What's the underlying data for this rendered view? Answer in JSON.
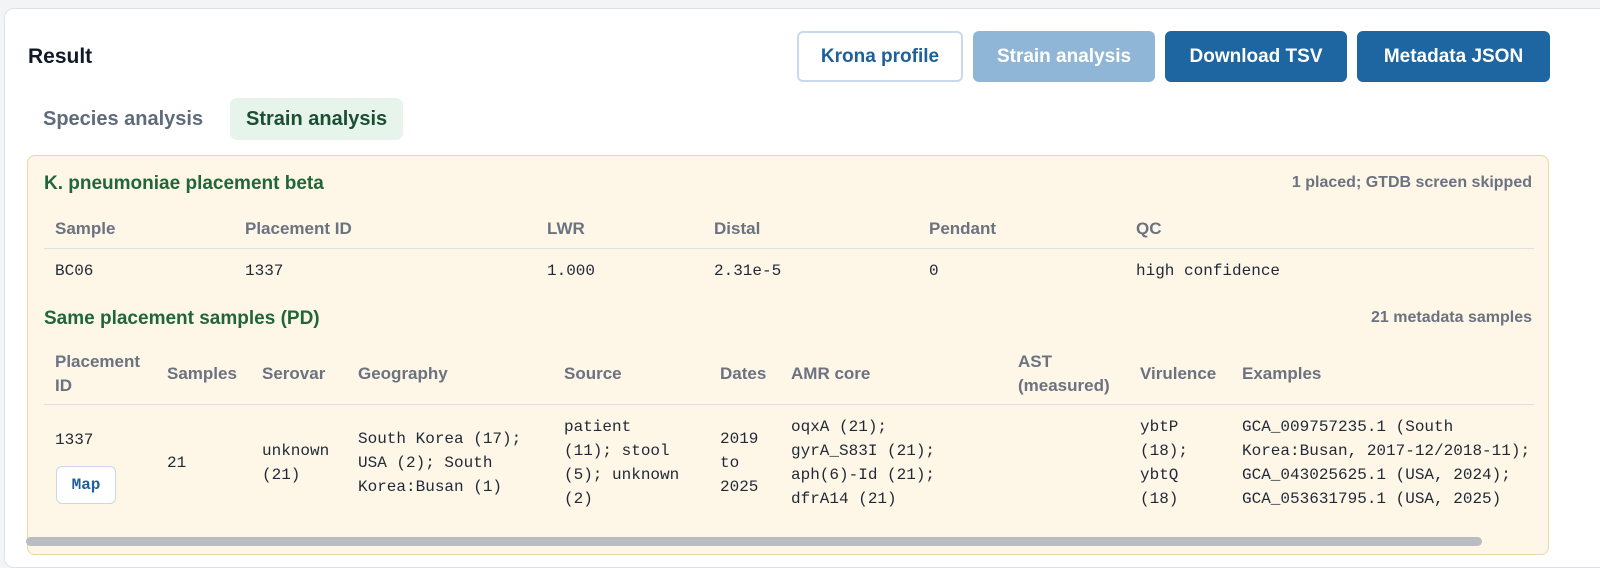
{
  "header": {
    "title": "Result"
  },
  "buttons": {
    "krona": "Krona profile",
    "strain": "Strain analysis",
    "tsv": "Download TSV",
    "json": "Metadata JSON"
  },
  "tabs": [
    {
      "label": "Species analysis",
      "active": false
    },
    {
      "label": "Strain analysis",
      "active": true
    }
  ],
  "placement": {
    "title": "K. pneumoniae placement beta",
    "note": "1 placed; GTDB screen skipped",
    "columns": [
      "Sample",
      "Placement ID",
      "LWR",
      "Distal",
      "Pendant",
      "QC"
    ],
    "rows": [
      [
        "BC06",
        "1337",
        "1.000",
        "2.31e-5",
        "0",
        "high confidence"
      ]
    ]
  },
  "same_placement": {
    "title": "Same placement samples (PD)",
    "note": "21 metadata samples",
    "columns": [
      "Placement\nID",
      "Samples",
      "Serovar",
      "Geography",
      "Source",
      "Dates",
      "AMR core",
      "AST\n(measured)",
      "Virulence",
      "Examples"
    ],
    "rows": [
      {
        "placement_id": "1337",
        "map_label": "Map",
        "samples": "21",
        "serovar": "unknown\n(21)",
        "geography": "South Korea (17);\nUSA (2); South\nKorea:Busan (1)",
        "source": "patient\n(11); stool\n(5); unknown\n(2)",
        "dates": "2019\nto\n2025",
        "amr_core": "oqxA (21);\ngyrA_S83I (21);\naph(6)-Id (21);\ndfrA14 (21)",
        "ast": "",
        "virulence": "ybtP\n(18);\nybtQ\n(18)",
        "examples": "GCA_009757235.1 (South\nKorea:Busan, 2017-12/2018-11);\nGCA_043025625.1 (USA, 2024);\nGCA_053631795.1 (USA, 2025)"
      }
    ]
  },
  "colors": {
    "primary": "#1d66a2",
    "primary_disabled": "#8fb6d6",
    "section_title": "#20663b",
    "panel_bg": "#fef6e6",
    "active_tab_bg": "#e6f4ec"
  }
}
